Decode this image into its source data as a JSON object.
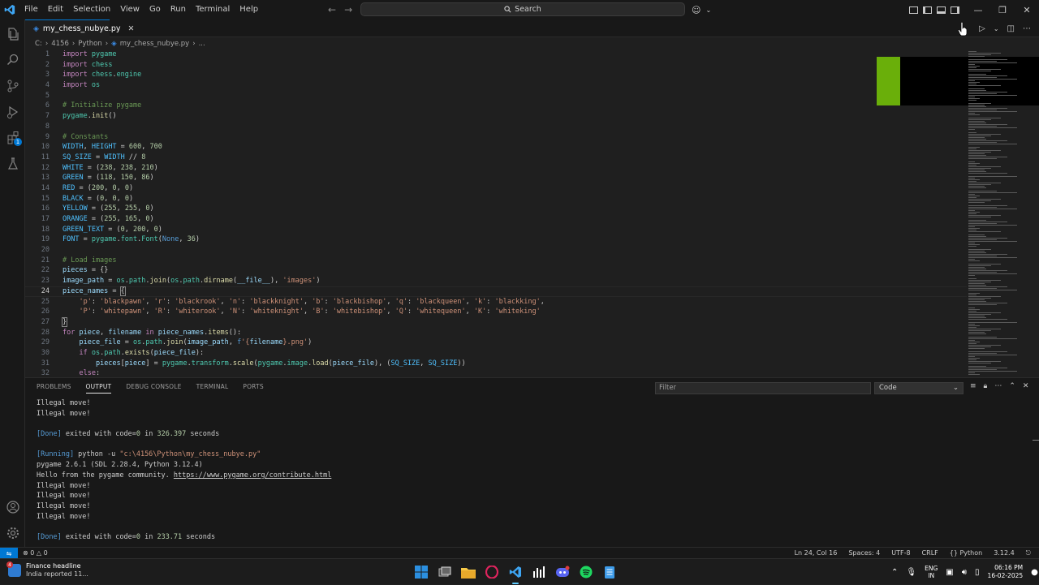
{
  "titlebar": {
    "menu": [
      "File",
      "Edit",
      "Selection",
      "View",
      "Go",
      "Run",
      "Terminal",
      "Help"
    ],
    "search_placeholder": "Search"
  },
  "tab": {
    "filename": "my_chess_nubye.py"
  },
  "breadcrumb": {
    "parts": [
      "C:",
      "4156",
      "Python",
      "my_chess_nubye.py",
      "..."
    ]
  },
  "editor": {
    "line_numbers": [
      "1",
      "2",
      "3",
      "4",
      "5",
      "6",
      "7",
      "8",
      "9",
      "10",
      "11",
      "12",
      "13",
      "14",
      "15",
      "16",
      "17",
      "18",
      "19",
      "20",
      "21",
      "22",
      "23",
      "24",
      "25",
      "26",
      "27",
      "28",
      "29",
      "30",
      "31",
      "32"
    ],
    "current_line": 24,
    "lines": [
      "import pygame",
      "import chess",
      "import chess.engine",
      "import os",
      "",
      "# Initialize pygame",
      "pygame.init()",
      "",
      "# Constants",
      "WIDTH, HEIGHT = 600, 700",
      "SQ_SIZE = WIDTH // 8",
      "WHITE = (238, 238, 210)",
      "GREEN = (118, 150, 86)",
      "RED = (200, 0, 0)",
      "BLACK = (0, 0, 0)",
      "YELLOW = (255, 255, 0)",
      "ORANGE = (255, 165, 0)",
      "GREEN_TEXT = (0, 200, 0)",
      "FONT = pygame.font.Font(None, 36)",
      "",
      "# Load images",
      "pieces = {}",
      "image_path = os.path.join(os.path.dirname(__file__), 'images')",
      "piece_names = {",
      "    'p': 'blackpawn', 'r': 'blackrook', 'n': 'blackknight', 'b': 'blackbishop', 'q': 'blackqueen', 'k': 'blackking',",
      "    'P': 'whitepawn', 'R': 'whiterook', 'N': 'whiteknight', 'B': 'whitebishop', 'Q': 'whitequeen', 'K': 'whiteking'",
      "}",
      "for piece, filename in piece_names.items():",
      "    piece_file = os.path.join(image_path, f'{filename}.png')",
      "    if os.path.exists(piece_file):",
      "        pieces[piece] = pygame.transform.scale(pygame.image.load(piece_file), (SQ_SIZE, SQ_SIZE))",
      "    else:"
    ]
  },
  "panel": {
    "tabs": [
      "PROBLEMS",
      "OUTPUT",
      "DEBUG CONSOLE",
      "TERMINAL",
      "PORTS"
    ],
    "active_tab": "OUTPUT",
    "filter_placeholder": "Filter",
    "channel": "Code",
    "output": [
      "Illegal move!",
      "Illegal move!",
      "",
      "[Done] exited with code=0 in 326.397 seconds",
      "",
      "[Running] python -u \"c:\\4156\\Python\\my_chess_nubye.py\"",
      "pygame 2.6.1 (SDL 2.28.4, Python 3.12.4)",
      "Hello from the pygame community. https://www.pygame.org/contribute.html",
      "Illegal move!",
      "Illegal move!",
      "Illegal move!",
      "Illegal move!",
      "",
      "[Done] exited with code=0 in 233.71 seconds"
    ]
  },
  "statusbar": {
    "errors": "0",
    "warnings": "0",
    "position": "Ln 24, Col 16",
    "spaces": "Spaces: 4",
    "encoding": "UTF-8",
    "eol": "CRLF",
    "language": "Python",
    "version": "3.12.4"
  },
  "taskbar": {
    "news_title": "Finance headline",
    "news_sub": "India reported 11...",
    "news_badge": "4",
    "lang_top": "ENG",
    "lang_bottom": "IN",
    "time": "06:16 PM",
    "date": "16-02-2025"
  },
  "colors": {
    "accent": "#0078d4",
    "green_block": "#6aaf0a"
  }
}
